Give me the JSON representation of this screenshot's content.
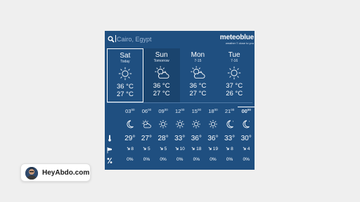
{
  "search": {
    "placeholder": "Cairo, Egypt"
  },
  "brand": {
    "logo": "meteoblue",
    "tagline": "weather ≡ close to you"
  },
  "days": [
    {
      "name": "Sat",
      "sub": "Today",
      "icon": "sun-icon",
      "max": "36 °C",
      "min": "27 °C"
    },
    {
      "name": "Sun",
      "sub": "Tomorrow",
      "icon": "sun-cloud-icon",
      "max": "36 °C",
      "min": "27 °C"
    },
    {
      "name": "Mon",
      "sub": "7-15",
      "icon": "sun-cloud-icon",
      "max": "36 °C",
      "min": "27 °C"
    },
    {
      "name": "Tue",
      "sub": "7-16",
      "icon": "sun-icon",
      "max": "37 °C",
      "min": "26 °C"
    }
  ],
  "hourly": {
    "hours": [
      {
        "h": "03",
        "m": "00"
      },
      {
        "h": "06",
        "m": "00"
      },
      {
        "h": "09",
        "m": "00"
      },
      {
        "h": "12",
        "m": "00"
      },
      {
        "h": "15",
        "m": "00"
      },
      {
        "h": "18",
        "m": "00"
      },
      {
        "h": "21",
        "m": "00"
      },
      {
        "h": "00",
        "m": "00"
      }
    ],
    "icons": [
      "moon-icon",
      "sun-cloud-icon",
      "sun-icon",
      "sun-icon",
      "sun-icon",
      "sun-icon",
      "moon-icon",
      "moon-icon"
    ],
    "temps": [
      "29°",
      "27°",
      "28°",
      "33°",
      "36°",
      "36°",
      "33°",
      "30°"
    ],
    "wind": [
      "8",
      "5",
      "5",
      "10",
      "18",
      "19",
      "8",
      "4"
    ],
    "precip": [
      "0%",
      "0%",
      "0%",
      "0%",
      "0%",
      "0%",
      "0%",
      "0%"
    ]
  },
  "card": {
    "label": "HeyAbdo.com"
  },
  "colors": {
    "widget_bg": "#1f4f80",
    "page_bg": "#efefef"
  }
}
